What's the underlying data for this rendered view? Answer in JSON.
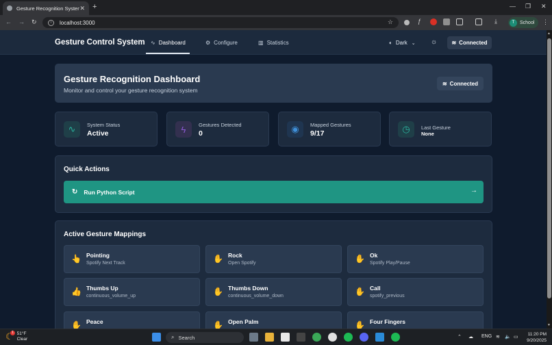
{
  "browser": {
    "tab_title": "Gesture Recognition System",
    "url": "localhost:3000",
    "profile_initial": "T",
    "profile_label": "School"
  },
  "app": {
    "brand": "Gesture Control System",
    "nav": [
      {
        "label": "Dashboard",
        "icon": "activity-icon",
        "active": true
      },
      {
        "label": "Configure",
        "icon": "gear-icon",
        "active": false
      },
      {
        "label": "Statistics",
        "icon": "bar-chart-icon",
        "active": false
      }
    ],
    "theme_label": "Dark",
    "connection_label": "Connected"
  },
  "hero": {
    "title": "Gesture Recognition Dashboard",
    "subtitle": "Monitor and control your gesture recognition system",
    "badge": "Connected"
  },
  "stats": [
    {
      "label": "System Status",
      "value": "Active",
      "icon": "activity-icon",
      "color": "#2bb5a0"
    },
    {
      "label": "Gestures Detected",
      "value": "0",
      "icon": "lightning-icon",
      "color": "#8e5bd8"
    },
    {
      "label": "Mapped Gestures",
      "value": "9/17",
      "icon": "eye-icon",
      "color": "#3f8fd8"
    },
    {
      "label": "Last Gesture",
      "value": "None",
      "icon": "clock-icon",
      "color": "#2bb5a0"
    }
  ],
  "quick_actions": {
    "title": "Quick Actions",
    "run_label": "Run Python Script"
  },
  "mappings": {
    "title": "Active Gesture Mappings",
    "items": [
      {
        "name": "Pointing",
        "action": "Spotify Next Track",
        "icon": "pointing-hand-icon"
      },
      {
        "name": "Rock",
        "action": "Open Spotify",
        "icon": "rock-hand-icon"
      },
      {
        "name": "Ok",
        "action": "Spotify Play/Pause",
        "icon": "ok-hand-icon"
      },
      {
        "name": "Thumbs Up",
        "action": "continuous_volume_up",
        "icon": "thumbs-up-icon"
      },
      {
        "name": "Thumbs Down",
        "action": "continuous_volume_down",
        "icon": "thumbs-down-icon"
      },
      {
        "name": "Call",
        "action": "spotify_previous",
        "icon": "call-hand-icon"
      },
      {
        "name": "Peace",
        "action": "",
        "icon": "peace-hand-icon"
      },
      {
        "name": "Open Palm",
        "action": "",
        "icon": "open-palm-icon"
      },
      {
        "name": "Four Fingers",
        "action": "",
        "icon": "four-fingers-icon"
      }
    ]
  },
  "taskbar": {
    "weather_temp": "51°F",
    "weather_desc": "Clear",
    "weather_badge": "1",
    "search_label": "Search",
    "lang": "ENG",
    "time": "11:20 PM",
    "date": "9/20/2025"
  }
}
